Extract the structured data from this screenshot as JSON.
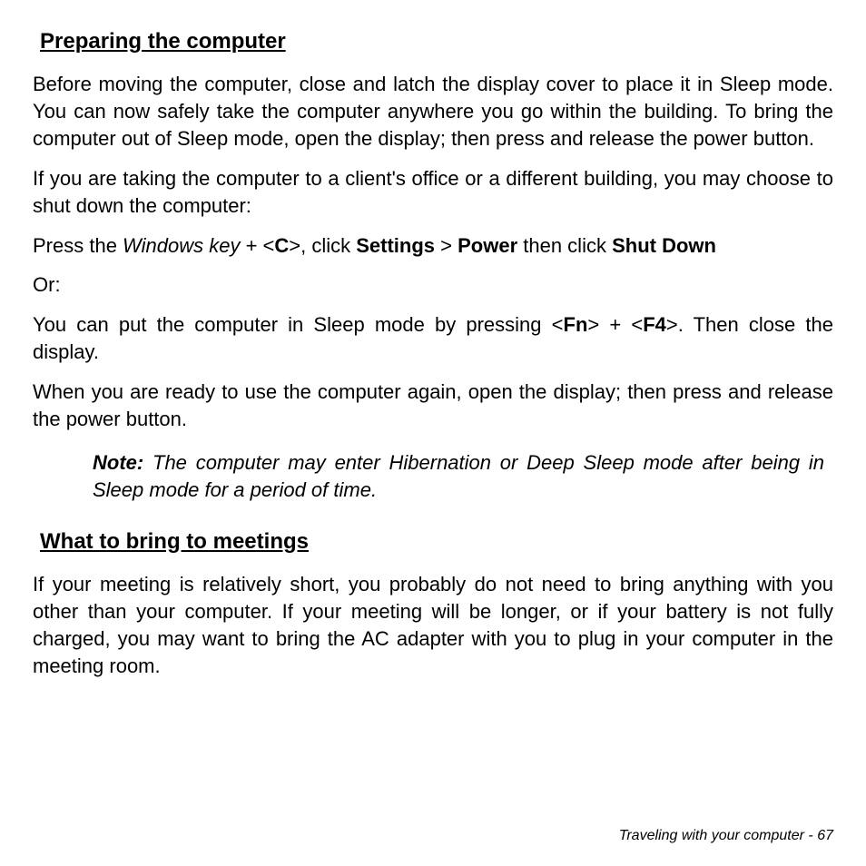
{
  "section1": {
    "heading": "Preparing the computer",
    "p1": "Before moving the computer, close and latch the display cover to place it in Sleep mode. You can now safely take the computer anywhere you go within the building. To bring the computer out of Sleep mode, open the display; then press and release the power button.",
    "p2": "If you are taking the computer to a client's office or a different building, you may choose to shut down the computer:",
    "p3_pre": "Press the ",
    "p3_winkey": "Windows key",
    "p3_plus": " + <",
    "p3_c": "C",
    "p3_gt": ">, click ",
    "p3_settings": "Settings",
    "p3_sep1": " > ",
    "p3_power": "Power",
    "p3_then": " then click ",
    "p3_shutdown": "Shut Down",
    "p4": "Or:",
    "p5_pre": "You can put the computer in Sleep mode by pressing <",
    "p5_fn": "Fn",
    "p5_mid": "> + <",
    "p5_f4": "F4",
    "p5_post": ">. Then close the display.",
    "p6": "When you are ready to use the computer again, open the display; then press and release the power button.",
    "note_label": "Note:",
    "note_text": " The computer may enter Hibernation or Deep Sleep mode after being in Sleep mode for a period of time."
  },
  "section2": {
    "heading": "What to bring to meetings",
    "p1": "If your meeting is relatively short, you probably do not need to bring anything with you other than your computer. If your meeting will be longer, or if your battery is not fully charged, you may want to bring the AC adapter with you to plug in your computer in the meeting room."
  },
  "footer": {
    "text": "Traveling with your computer -  67"
  }
}
